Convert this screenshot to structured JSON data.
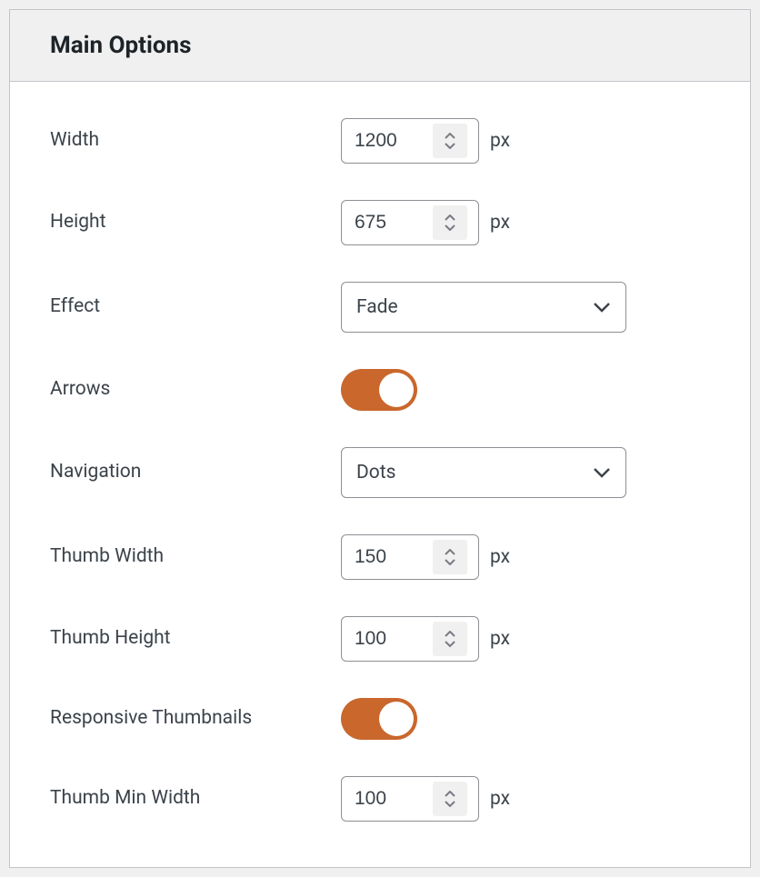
{
  "panel": {
    "title": "Main Options"
  },
  "fields": {
    "width": {
      "label": "Width",
      "value": "1200",
      "unit": "px"
    },
    "height": {
      "label": "Height",
      "value": "675",
      "unit": "px"
    },
    "effect": {
      "label": "Effect",
      "value": "Fade"
    },
    "arrows": {
      "label": "Arrows"
    },
    "navigation": {
      "label": "Navigation",
      "value": "Dots"
    },
    "thumbWidth": {
      "label": "Thumb Width",
      "value": "150",
      "unit": "px"
    },
    "thumbHeight": {
      "label": "Thumb Height",
      "value": "100",
      "unit": "px"
    },
    "responsiveThumbs": {
      "label": "Responsive Thumbnails"
    },
    "thumbMinWidth": {
      "label": "Thumb Min Width",
      "value": "100",
      "unit": "px"
    }
  }
}
